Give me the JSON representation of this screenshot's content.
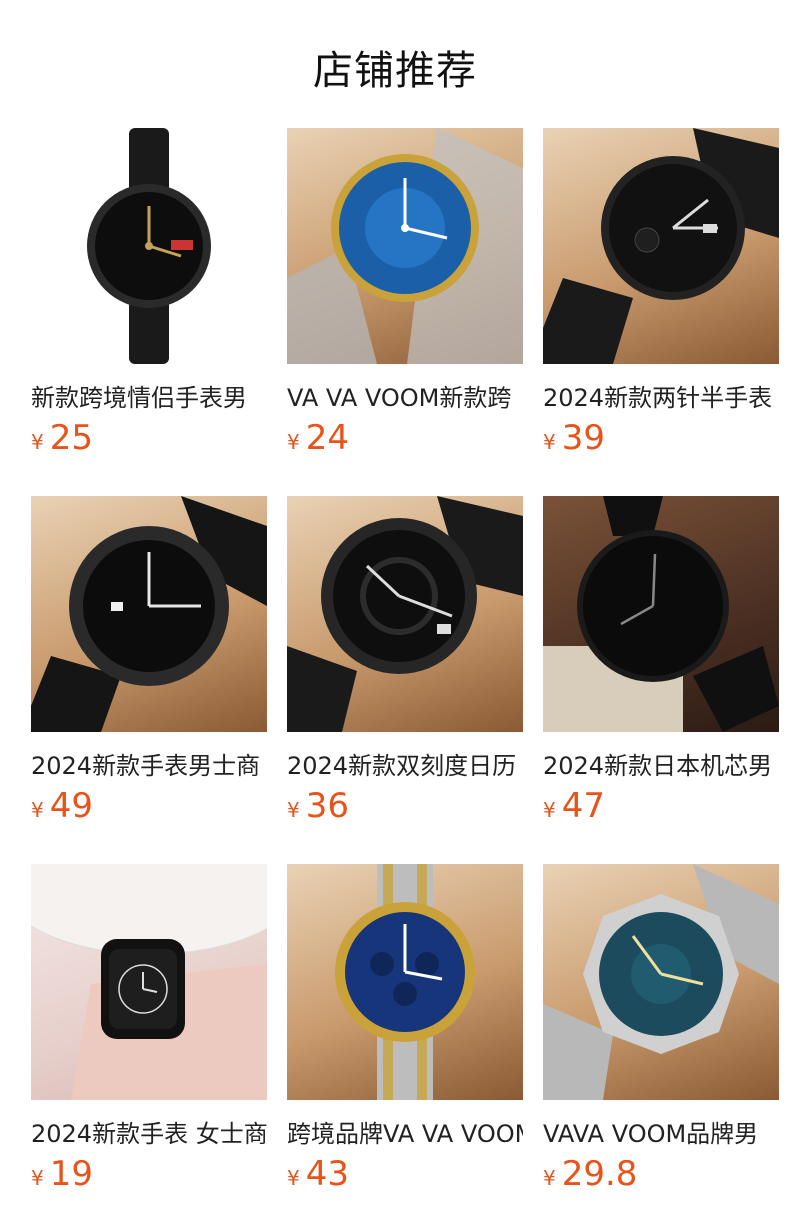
{
  "header": {
    "title": "店铺推荐"
  },
  "currency": "¥",
  "products": [
    {
      "name": "新款跨境情侣手表男",
      "price": "25"
    },
    {
      "name": "VA VA VOOM新款跨",
      "price": "24"
    },
    {
      "name": "2024新款两针半手表",
      "price": "39"
    },
    {
      "name": "2024新款手表男士商",
      "price": "49"
    },
    {
      "name": "2024新款双刻度日历",
      "price": "36"
    },
    {
      "name": "2024新款日本机芯男",
      "price": "47"
    },
    {
      "name": "2024新款手表 女士商",
      "price": "19"
    },
    {
      "name": "跨境品牌VA VA VOOM",
      "price": "43"
    },
    {
      "name": "VAVA VOOM品牌男",
      "price": "29.8"
    }
  ],
  "colors": {
    "price": "#e8531a",
    "title": "#111111",
    "name": "#222222"
  }
}
